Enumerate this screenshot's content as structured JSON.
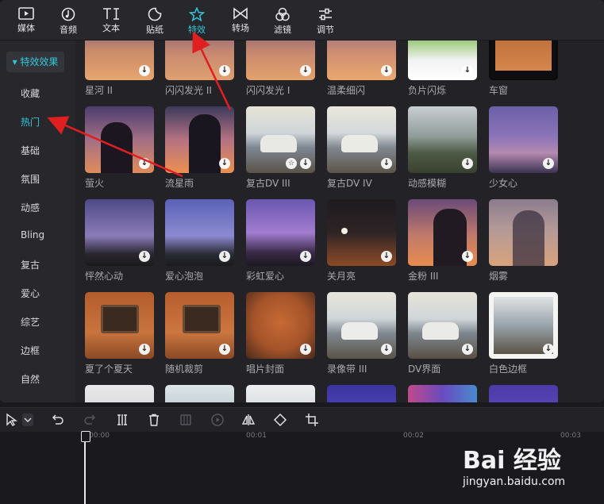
{
  "toolbar": {
    "items": [
      {
        "label": "媒体",
        "icon": "media-icon"
      },
      {
        "label": "音频",
        "icon": "audio-icon"
      },
      {
        "label": "文本",
        "icon": "text-icon"
      },
      {
        "label": "贴纸",
        "icon": "sticker-icon"
      },
      {
        "label": "特效",
        "icon": "effects-star-icon"
      },
      {
        "label": "转场",
        "icon": "transition-icon"
      },
      {
        "label": "滤镜",
        "icon": "filter-icon"
      },
      {
        "label": "调节",
        "icon": "adjust-icon"
      }
    ],
    "active_index": 4
  },
  "sidebar": {
    "header": "特效效果",
    "items": [
      "收藏",
      "热门",
      "基础",
      "氛围",
      "动感",
      "Bling",
      "复古",
      "爱心",
      "综艺",
      "边框",
      "自然"
    ],
    "active": "热门"
  },
  "effects": {
    "rows": [
      [
        "星河 II",
        "闪闪发光 II",
        "闪闪发光 I",
        "温柔细闪",
        "负片闪烁",
        "车窗"
      ],
      [
        "萤火",
        "流星雨",
        "复古DV III",
        "复古DV IV",
        "动感模糊",
        "少女心"
      ],
      [
        "怦然心动",
        "爱心泡泡",
        "彩虹爱心",
        "关月亮",
        "金粉 III",
        "烟雾"
      ],
      [
        "夏了个夏天",
        "随机裁剪",
        "唱片封面",
        "录像带 III",
        "DV界面",
        "白色边框"
      ]
    ]
  },
  "timeline": {
    "ticks": [
      "00:00",
      "00:01",
      "00:02",
      "00:03"
    ]
  },
  "watermark": {
    "logo": "Bai 经验",
    "url": "jingyan.baidu.com"
  },
  "colors": {
    "accent": "#30c8d8",
    "arrow": "#e02020"
  }
}
